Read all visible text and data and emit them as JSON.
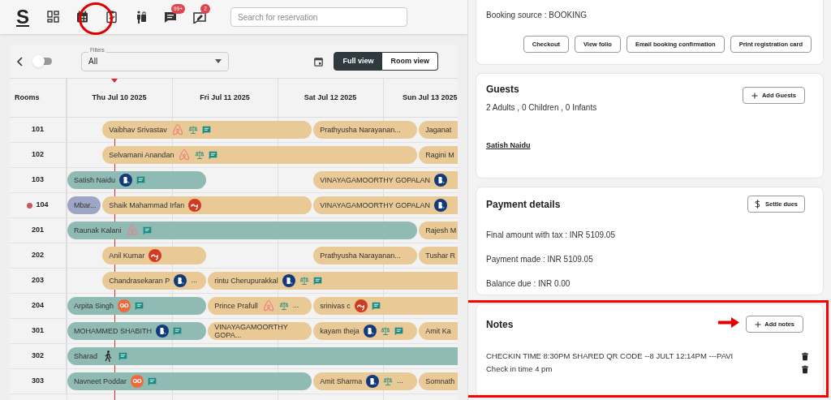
{
  "top_bar": {
    "logo": "S",
    "icons": [
      {
        "kind": "dashboard"
      },
      {
        "kind": "calendar"
      },
      {
        "kind": "clipboard"
      },
      {
        "kind": "luggage"
      },
      {
        "kind": "chat",
        "badge": "99+"
      },
      {
        "kind": "review",
        "badge": "2"
      }
    ],
    "search": {
      "placeholder": "Search for reservation"
    }
  },
  "toolbar": {
    "toggle_on": false,
    "filter": {
      "label": "Filters",
      "value": "All"
    },
    "views": [
      {
        "label": "Full view",
        "selected": true
      },
      {
        "label": "Room view",
        "selected": false
      }
    ]
  },
  "calendar": {
    "rooms_header": "Rooms",
    "days": [
      "Thu Jul 10 2025",
      "Fri Jul 11 2025",
      "Sat Jul 12 2025",
      "Sun Jul 13 2025"
    ],
    "rooms": [
      {
        "number": "101",
        "alert": false,
        "bookings": [
          {
            "guest": "Vaibhav Srivastav",
            "color": "#e9c995",
            "kind": "airbnb",
            "balance": true,
            "note": true
          },
          {
            "guest": "Prathyusha Narayanan...",
            "color": "#e9c995"
          },
          {
            "guest": "Jaganat",
            "color": "#e9c995"
          }
        ]
      },
      {
        "number": "102",
        "alert": false,
        "bookings": [
          {
            "guest": "Selvamani Anandan",
            "color": "#e9c995",
            "kind": "airbnb",
            "balance": true,
            "note": true
          },
          {
            "guest": "Ragini M",
            "color": "#e9c995"
          }
        ]
      },
      {
        "number": "103",
        "alert": false,
        "bookings": [
          {
            "guest": "Satish Naidu",
            "color": "#8fbbb4",
            "kind": "booking",
            "note": true
          },
          {
            "guest": "VINAYAGAMOORTHY GOPALAN",
            "color": "#e9c995",
            "kind": "booking"
          }
        ]
      },
      {
        "number": "104",
        "alert": true,
        "bookings": [
          {
            "guest": "Mbar...",
            "color": "#9ea6c6"
          },
          {
            "guest": "Shaik Mahammad Irfan",
            "color": "#e9c995",
            "kind": "makemytrip"
          },
          {
            "guest": "VINAYAGAMOORTHY GOPALAN",
            "color": "#e9c995",
            "kind": "booking"
          }
        ]
      },
      {
        "number": "201",
        "alert": false,
        "bookings": [
          {
            "guest": "Raunak Kalani",
            "color": "#8fbbb4",
            "kind": "airbnb",
            "note": true
          },
          {
            "guest": "Rajesh M",
            "color": "#e9c995"
          }
        ]
      },
      {
        "number": "202",
        "alert": false,
        "bookings": [
          {
            "guest": "Anil Kumar",
            "color": "#e9c995",
            "kind": "makemytrip"
          },
          {
            "guest": "Prathyusha Narayanan...",
            "color": "#e9c995"
          },
          {
            "guest": "Tushar R",
            "color": "#e9c995"
          }
        ]
      },
      {
        "number": "203",
        "alert": false,
        "bookings": [
          {
            "guest": "Chandrasekaran P",
            "color": "#e9c995",
            "kind": "booking",
            "more": "..."
          },
          {
            "guest": "rintu Cherupurakkal",
            "color": "#e9c995",
            "kind": "booking",
            "balance": true,
            "note": true
          }
        ]
      },
      {
        "number": "204",
        "alert": false,
        "bookings": [
          {
            "guest": "Arpita Singh",
            "color": "#8fbbb4",
            "kind": "goibibo",
            "note": true
          },
          {
            "guest": "Prince Prafull",
            "color": "#e9c995",
            "kind": "airbnb",
            "balance": true,
            "more": "..."
          },
          {
            "guest": "srinivas c",
            "color": "#e9c995",
            "kind": "makemytrip",
            "note": true
          }
        ]
      },
      {
        "number": "301",
        "alert": false,
        "bookings": [
          {
            "guest": "MOHAMMED SHABITH",
            "color": "#8fbbb4",
            "kind": "booking",
            "note": true
          },
          {
            "guest": "VINAYAGAMOORTHY GOPA...",
            "color": "#e9c995"
          },
          {
            "guest": "kayam theja",
            "color": "#e9c995",
            "kind": "booking",
            "balance": true,
            "note": true
          },
          {
            "guest": "Amit Ka",
            "color": "#e9c995"
          }
        ]
      },
      {
        "number": "302",
        "alert": false,
        "bookings": [
          {
            "guest": "Sharad",
            "color": "#8fbbb4",
            "kind": "walk-in",
            "note": true
          }
        ]
      },
      {
        "number": "303",
        "alert": false,
        "bookings": [
          {
            "guest": "Navneet Poddar",
            "color": "#8fbbb4",
            "kind": "goibibo",
            "note": true
          },
          {
            "guest": "Amit Sharma",
            "color": "#e9c995",
            "kind": "booking",
            "balance": true,
            "more": "..."
          },
          {
            "guest": "Somnath",
            "color": "#e9c995"
          }
        ]
      }
    ]
  },
  "details": {
    "booking_source": "Booking source : BOOKING",
    "actions": [
      "Checkout",
      "View folio",
      "Email booking confirmation",
      "Print registration card"
    ],
    "guests": {
      "title": "Guests",
      "summary": "2 Adults , 0 Children , 0 Infants",
      "add_button": "Add Guests",
      "names": [
        "Satish Naidu"
      ]
    },
    "payment": {
      "title": "Payment details",
      "settle_button": "Settle dues",
      "lines": [
        "Final amount with tax : INR 5109.05",
        "Payment made : INR 5109.05",
        "Balance due : INR 0.00"
      ]
    },
    "notes": {
      "title": "Notes",
      "add_button": "Add notes",
      "items": [
        "CHECKIN TIME 8:30PM SHARED QR CODE --8 JULT 12:14PM ---PAVI",
        "Check in time 4 pm"
      ]
    }
  }
}
